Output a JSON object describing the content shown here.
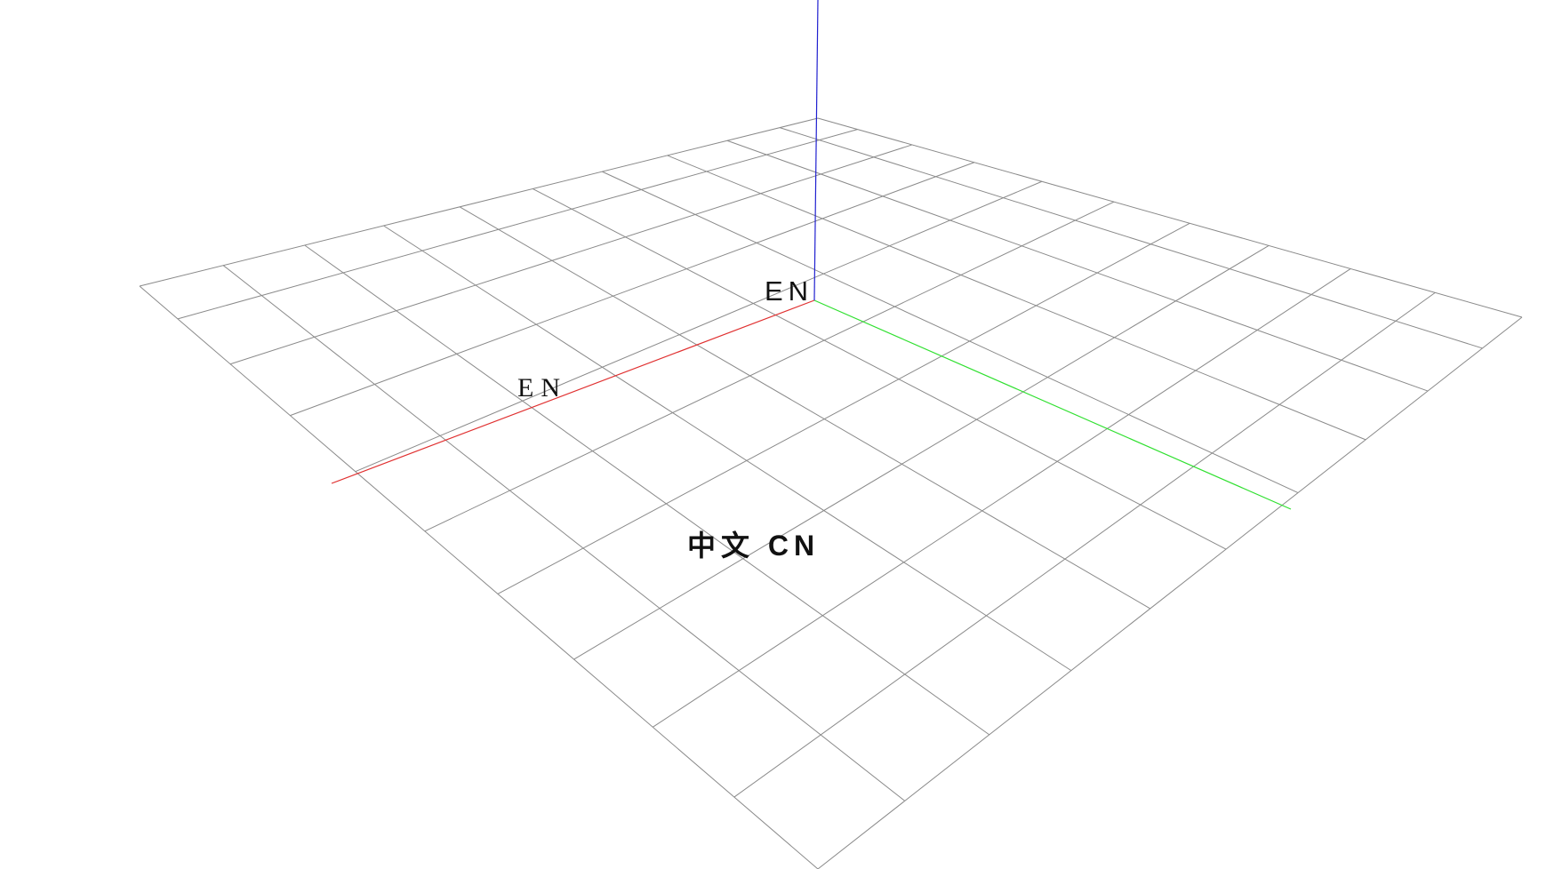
{
  "scene": {
    "background": "#ffffff",
    "grid": {
      "divisions": 10,
      "color": "#8a8a8a"
    },
    "axes": {
      "x": {
        "color": "#e03030"
      },
      "y": {
        "color": "#30e030"
      },
      "z": {
        "color": "#2020d0"
      }
    },
    "labels": {
      "origin_text": "EN",
      "x_axis_text": "EN",
      "ground_text": "中文 CN"
    }
  }
}
